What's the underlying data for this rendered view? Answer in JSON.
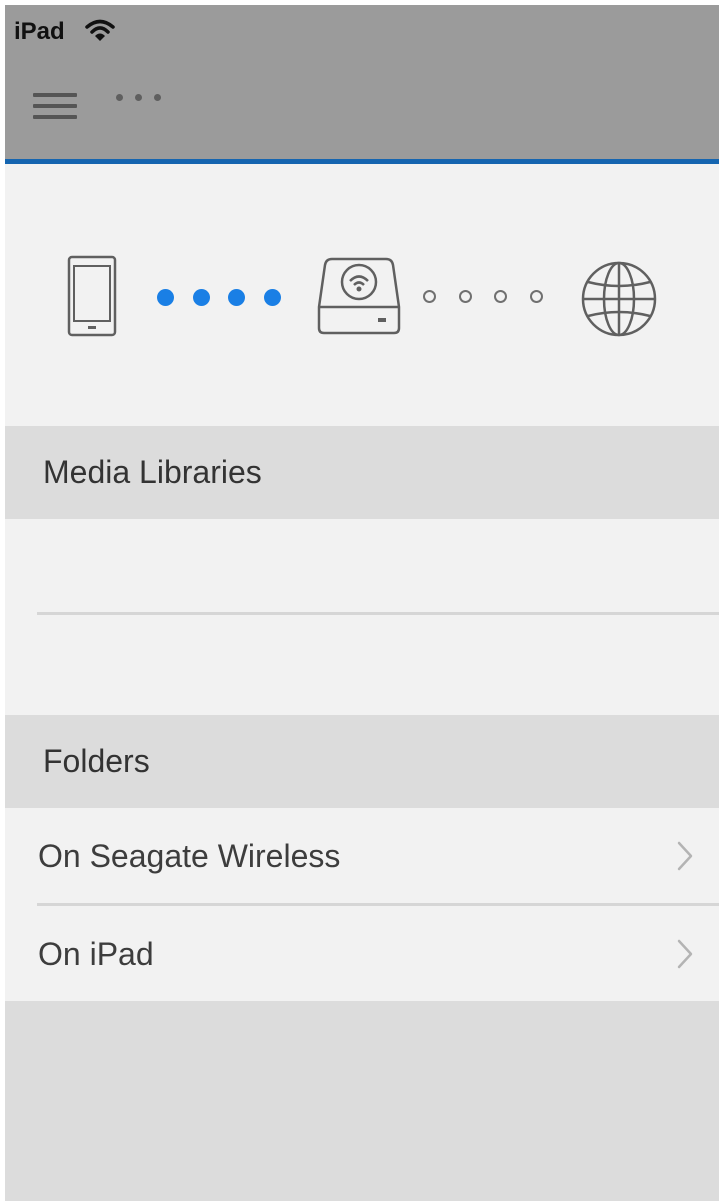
{
  "status_bar": {
    "device": "iPad",
    "icon": "wifi-icon"
  },
  "nav_bar": {
    "menu_icon": "hamburger-icon",
    "more_icon": "more-dots-icon"
  },
  "connection": {
    "icons": [
      "phone-icon",
      "wireless-drive-icon",
      "globe-icon"
    ],
    "device_to_drive": "connected",
    "drive_to_internet": "disconnected",
    "colors": {
      "connected": "#1a7fe5",
      "disconnected": "#707070",
      "accent": "#1565b0"
    }
  },
  "sections": {
    "media_libraries": {
      "title": "Media Libraries"
    },
    "folders": {
      "title": "Folders",
      "items": [
        {
          "label": "On Seagate Wireless",
          "icon": "chevron-right-icon"
        },
        {
          "label": "On iPad",
          "icon": "chevron-right-icon"
        }
      ]
    }
  }
}
